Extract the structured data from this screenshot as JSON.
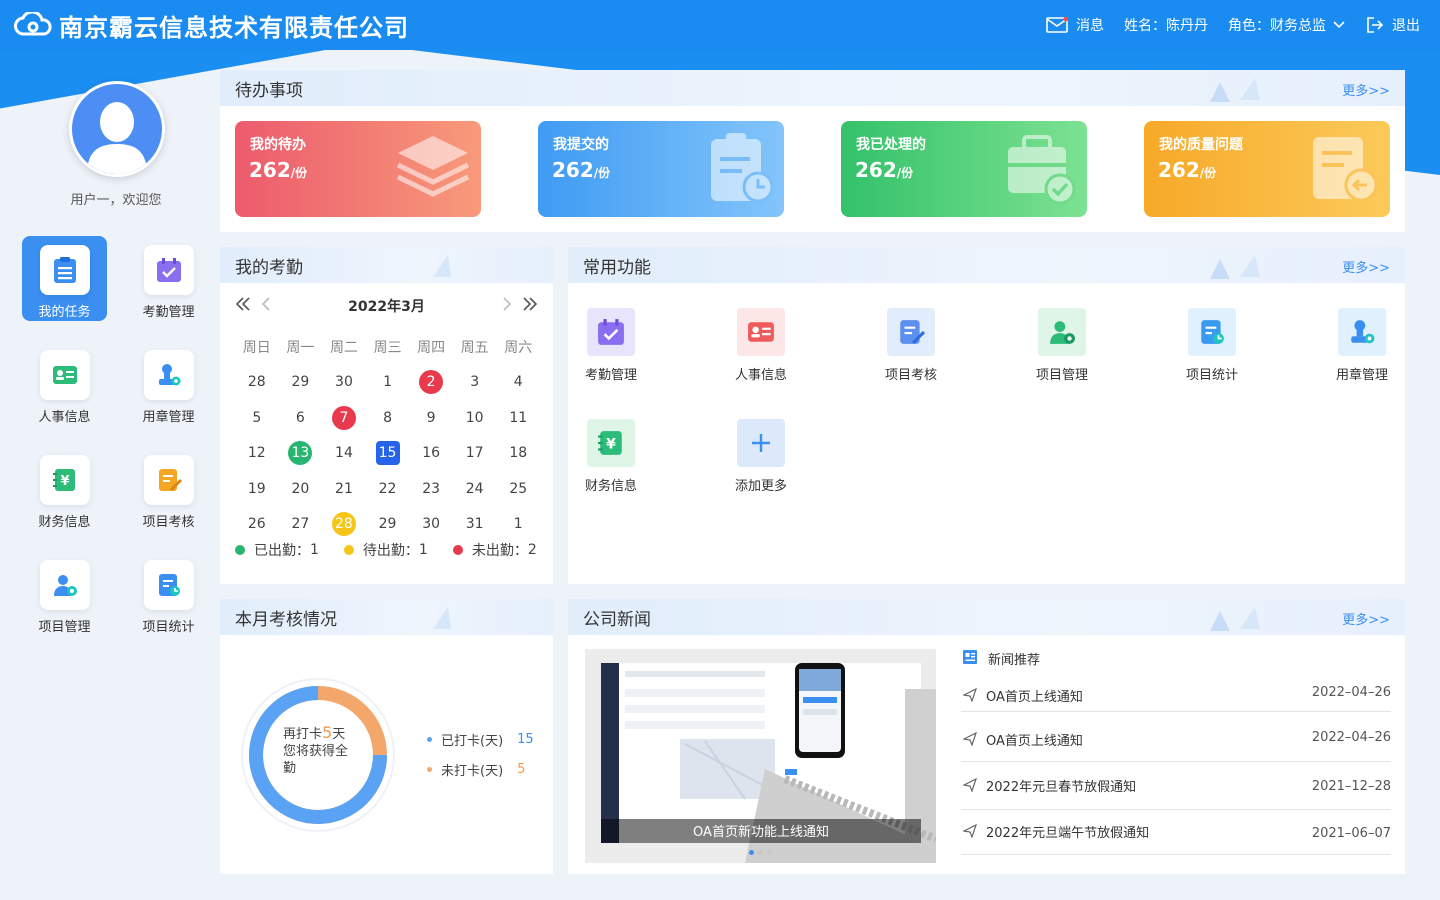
{
  "header": {
    "company": "南京霸云信息技术有限责任公司",
    "message_label": "消息",
    "name_label": "姓名：陈丹丹",
    "role_label": "角色：财务总监",
    "logout_label": "退出"
  },
  "sidebar": {
    "welcome": "用户一，欢迎您",
    "items": [
      {
        "label": "我的任务",
        "icon": "task-list-icon",
        "active": true
      },
      {
        "label": "考勤管理",
        "icon": "calendar-check-icon"
      },
      {
        "label": "人事信息",
        "icon": "id-card-icon"
      },
      {
        "label": "用章管理",
        "icon": "seal-icon"
      },
      {
        "label": "财务信息",
        "icon": "finance-icon"
      },
      {
        "label": "项目考核",
        "icon": "project-check-icon"
      },
      {
        "label": "项目管理",
        "icon": "user-gear-icon"
      },
      {
        "label": "项目统计",
        "icon": "statistics-icon"
      }
    ]
  },
  "todo": {
    "title": "待办事项",
    "more": "更多>>",
    "cards": [
      {
        "title": "我的待办",
        "count": "262",
        "unit": "/份",
        "color": "#ee6a77"
      },
      {
        "title": "我提交的",
        "count": "262",
        "unit": "/份",
        "color": "#53a7f6"
      },
      {
        "title": "我已处理的",
        "count": "262",
        "unit": "/份",
        "color": "#4fd47c"
      },
      {
        "title": "我的质量问题",
        "count": "262",
        "unit": "/份",
        "color": "#f9b33f"
      }
    ]
  },
  "attendance": {
    "title": "我的考勤",
    "month": "2022年3月",
    "weekdays": [
      "周日",
      "周一",
      "周二",
      "周三",
      "周四",
      "周五",
      "周六"
    ],
    "weeks": [
      [
        "28",
        "29",
        "30",
        "1",
        "2",
        "3",
        "4"
      ],
      [
        "5",
        "6",
        "7",
        "8",
        "9",
        "10",
        "11"
      ],
      [
        "12",
        "13",
        "14",
        "15",
        "16",
        "17",
        "18"
      ],
      [
        "19",
        "20",
        "21",
        "22",
        "23",
        "24",
        "25"
      ],
      [
        "26",
        "27",
        "28",
        "29",
        "30",
        "31",
        "1"
      ]
    ],
    "marked": {
      "0-4": "#e8394d",
      "1-2": "#e8394d",
      "2-1": "#27b571",
      "2-3": "#2563e8",
      "4-2": "#f5c518"
    },
    "legend": [
      {
        "label": "已出勤：",
        "value": "1",
        "color": "#27b571"
      },
      {
        "label": "待出勤：",
        "value": "1",
        "color": "#f5c518"
      },
      {
        "label": "未出勤：",
        "value": "2",
        "color": "#e8394d"
      }
    ]
  },
  "functions": {
    "title": "常用功能",
    "more": "更多>>",
    "items": [
      {
        "label": "考勤管理",
        "icon": "calendar-check-icon"
      },
      {
        "label": "人事信息",
        "icon": "id-card-icon"
      },
      {
        "label": "项目考核",
        "icon": "project-check-icon"
      },
      {
        "label": "项目管理",
        "icon": "user-gear-icon"
      },
      {
        "label": "项目统计",
        "icon": "statistics-icon"
      },
      {
        "label": "用章管理",
        "icon": "seal-icon"
      },
      {
        "label": "财务信息",
        "icon": "finance-icon"
      },
      {
        "label": "添加更多",
        "icon": "plus-icon"
      }
    ]
  },
  "assessment": {
    "title": "本月考核情况",
    "center_prefix": "再打卡",
    "center_number": "5",
    "center_suffix": "天",
    "center_line2": "您将获得全",
    "center_line3": "勤",
    "checked_label": "已打卡(天)",
    "checked_value": "15",
    "unchecked_label": "未打卡(天)",
    "unchecked_value": "5",
    "checked_fraction": 0.75,
    "colors": {
      "checked": "#5aa2f3",
      "unchecked": "#f3a76a"
    }
  },
  "news": {
    "title": "公司新闻",
    "more": "更多>>",
    "caption": "OA首页新功能上线通知",
    "list_title": "新闻推荐",
    "items": [
      {
        "title": "OA首页上线通知",
        "date": "2022–04–26"
      },
      {
        "title": "OA首页上线通知",
        "date": "2022–04–26"
      },
      {
        "title": "2022年元旦春节放假通知",
        "date": "2021–12–28"
      },
      {
        "title": "2022年元旦端午节放假通知",
        "date": "2021–06–07"
      }
    ]
  }
}
